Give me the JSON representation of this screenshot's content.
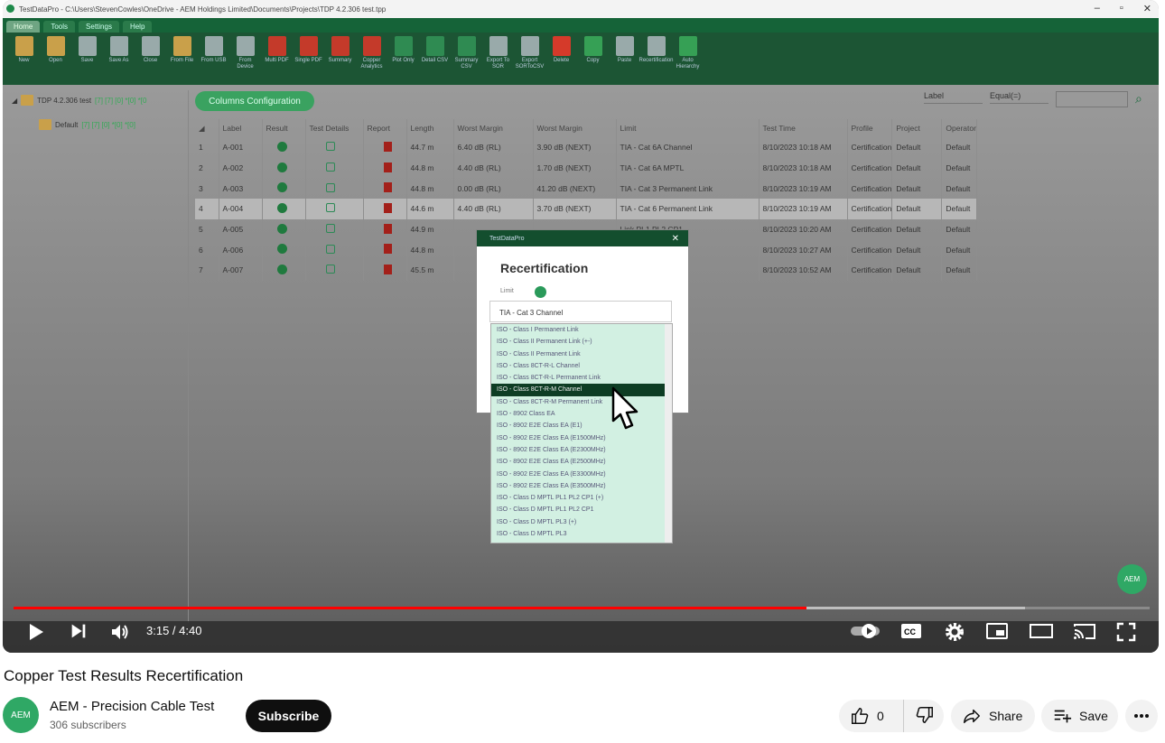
{
  "app": {
    "window_title": "TestDataPro - C:\\Users\\StevenCowles\\OneDrive - AEM Holdings Limited\\Documents\\Projects\\TDP 4.2.306 test.tpp",
    "menu": [
      "Home",
      "Tools",
      "Settings",
      "Help"
    ],
    "ribbon": [
      {
        "label": "New",
        "icon": "folder"
      },
      {
        "label": "Open",
        "icon": "folder"
      },
      {
        "label": "Save",
        "icon": "save"
      },
      {
        "label": "Save As",
        "icon": "save"
      },
      {
        "label": "Close",
        "icon": "close"
      },
      {
        "label": "From File",
        "icon": "file"
      },
      {
        "label": "From USB",
        "icon": "usb"
      },
      {
        "label": "From Device",
        "icon": "device"
      },
      {
        "label": "Multi PDF",
        "icon": "pdf"
      },
      {
        "label": "Single PDF",
        "icon": "pdf"
      },
      {
        "label": "Summary",
        "icon": "pdf"
      },
      {
        "label": "Copper Analytics",
        "icon": "pdf"
      },
      {
        "label": "Plot Only",
        "icon": "csv"
      },
      {
        "label": "Detail CSV",
        "icon": "csv"
      },
      {
        "label": "Summary CSV",
        "icon": "csv"
      },
      {
        "label": "Export To SOR",
        "icon": "doc"
      },
      {
        "label": "Export SORToCSV",
        "icon": "doc"
      },
      {
        "label": "Delete",
        "icon": "delete"
      },
      {
        "label": "Copy",
        "icon": "copy"
      },
      {
        "label": "Paste",
        "icon": "paste"
      },
      {
        "label": "Recertification",
        "icon": "recert"
      },
      {
        "label": "Auto Hierarchy",
        "icon": "hierarchy"
      }
    ],
    "tree_root": "TDP 4.2.306 test",
    "tree_root_counts": "[7] [7] [0] *[0] *[0",
    "tree_child": "Default",
    "tree_child_counts": "[7] [7] [0] *[0] *[0]",
    "columns_button": "Columns Configuration",
    "filter_field": "Label",
    "filter_op": "Equal(=)",
    "columns": [
      "Label",
      "Result",
      "Test Details",
      "Report",
      "Length",
      "Worst Margin",
      "Worst Margin",
      "Limit",
      "Test Time",
      "Profile",
      "Project",
      "Operator"
    ],
    "rows": [
      {
        "n": "1",
        "label": "A-001",
        "length": "44.7 m",
        "wm1": "6.40 dB (RL)",
        "wm2": "3.90 dB (NEXT)",
        "limit": "TIA - Cat 6A Channel",
        "time": "8/10/2023 10:18 AM",
        "profile": "Certification",
        "project": "Default",
        "operator": "Default"
      },
      {
        "n": "2",
        "label": "A-002",
        "length": "44.8 m",
        "wm1": "4.40 dB (RL)",
        "wm2": "1.70 dB (NEXT)",
        "limit": "TIA - Cat 6A MPTL",
        "time": "8/10/2023 10:18 AM",
        "profile": "Certification",
        "project": "Default",
        "operator": "Default"
      },
      {
        "n": "3",
        "label": "A-003",
        "length": "44.8 m",
        "wm1": "0.00 dB (RL)",
        "wm2": "41.20 dB (NEXT)",
        "limit": "TIA - Cat 3 Permanent Link",
        "time": "8/10/2023 10:19 AM",
        "profile": "Certification",
        "project": "Default",
        "operator": "Default"
      },
      {
        "n": "4",
        "label": "A-004",
        "length": "44.6 m",
        "wm1": "4.40 dB (RL)",
        "wm2": "3.70 dB (NEXT)",
        "limit": "TIA - Cat 6 Permanent Link",
        "time": "8/10/2023 10:19 AM",
        "profile": "Certification",
        "project": "Default",
        "operator": "Default"
      },
      {
        "n": "5",
        "label": "A-005",
        "length": "44.9 m",
        "wm1": "",
        "wm2": "",
        "limit": "Link PL1 PL2 CP1",
        "time": "8/10/2023 10:20 AM",
        "profile": "Certification",
        "project": "Default",
        "operator": "Default"
      },
      {
        "n": "6",
        "label": "A-006",
        "length": "44.8 m",
        "wm1": "",
        "wm2": "",
        "limit": "Permanent Link",
        "time": "8/10/2023 10:27 AM",
        "profile": "Certification",
        "project": "Default",
        "operator": "Default"
      },
      {
        "n": "7",
        "label": "A-007",
        "length": "45.5 m",
        "wm1": "",
        "wm2": "",
        "limit": "Channel",
        "time": "8/10/2023 10:52 AM",
        "profile": "Certification",
        "project": "Default",
        "operator": "Default"
      }
    ],
    "dialog": {
      "app_name": "TestDataPro",
      "title": "Recertification",
      "limit_label": "Limit",
      "selected": "TIA - Cat 3 Channel",
      "options": [
        "ISO - Class I Permanent Link",
        "ISO - Class II Permanent Link (+-)",
        "ISO - Class II Permanent Link",
        "ISO - Class 8CT-R-L Channel",
        "ISO - Class 8CT-R-L Permanent Link",
        "ISO - Class 8CT-R-M Channel",
        "ISO - Class 8CT-R-M Permanent Link",
        "ISO - 8902 Class EA",
        "ISO - 8902 E2E Class EA (E1)",
        "ISO - 8902 E2E Class EA (E1500MHz)",
        "ISO - 8902 E2E Class EA (E2300MHz)",
        "ISO - 8902 E2E Class EA (E2500MHz)",
        "ISO - 8902 E2E Class EA (E3300MHz)",
        "ISO - 8902 E2E Class EA (E3500MHz)",
        "ISO - Class D MPTL PL1 PL2 CP1 (+)",
        "ISO - Class D MPTL PL1 PL2 CP1",
        "ISO - Class D MPTL PL3 (+)",
        "ISO - Class D MPTL PL3"
      ],
      "highlighted_index": 5
    },
    "badge": "AEM"
  },
  "player": {
    "time": "3:15 / 4:40",
    "progress_played": 0.698,
    "progress_buffered": 0.89,
    "accent": "#ff0000"
  },
  "video": {
    "title": "Copper Test Results Recertification",
    "channel": "AEM - Precision Cable Test",
    "subscribers": "306 subscribers",
    "avatar_text": "AEM",
    "subscribe": "Subscribe",
    "likes": "0",
    "share": "Share",
    "save": "Save"
  }
}
